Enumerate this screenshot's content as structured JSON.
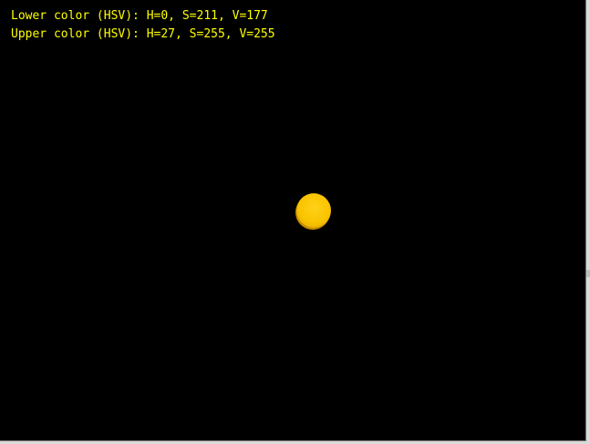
{
  "overlay": {
    "lower_color_text": "Lower color (HSV): H=0, S=211, V=177",
    "upper_color_text": "Upper color (HSV): H=27, S=255, V=255",
    "text_color": "#ffff00"
  },
  "detected_object": {
    "shape": "circle",
    "color": "#f9c400"
  },
  "colors": {
    "background": "#000000"
  }
}
